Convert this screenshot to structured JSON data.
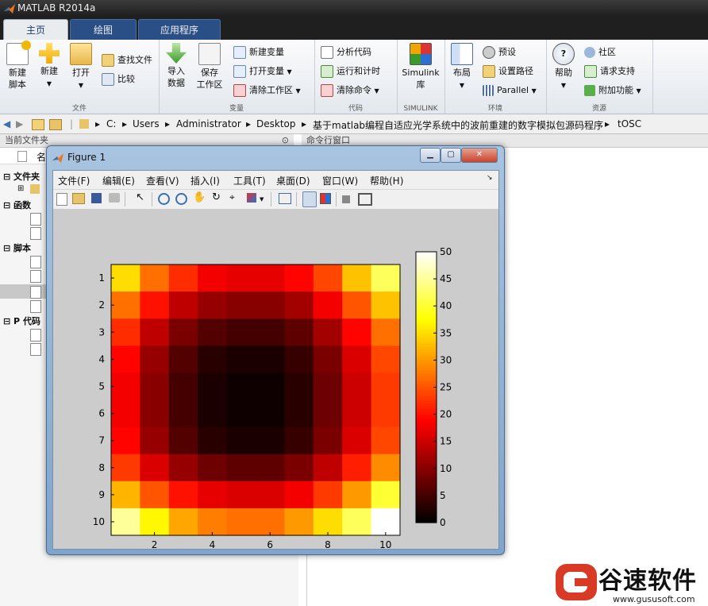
{
  "app": {
    "title": "MATLAB R2014a"
  },
  "tabs": [
    {
      "label": "主页",
      "active": true
    },
    {
      "label": "绘图"
    },
    {
      "label": "应用程序"
    }
  ],
  "ribbon": {
    "file": {
      "new_script": "新建\n脚本",
      "new": "新建",
      "open": "打开",
      "find_files": "查找文件",
      "compare": "比较",
      "title": "文件"
    },
    "variable": {
      "import": "导入\n数据",
      "save_ws": "保存\n工作区",
      "new_var": "新建变量",
      "open_var": "打开变量",
      "clear_ws": "清除工作区",
      "title": "变量"
    },
    "code": {
      "analyze": "分析代码",
      "run_time": "运行和计时",
      "clear_cmd": "清除命令",
      "title": "代码"
    },
    "simulink": {
      "lib": "Simulink\n库",
      "title": "SIMULINK"
    },
    "env": {
      "layout": "布局",
      "prefs": "预设",
      "set_path": "设置路径",
      "parallel": "Parallel",
      "title": "环境"
    },
    "res": {
      "help": "帮助",
      "community": "社区",
      "support": "请求支持",
      "addons": "附加功能",
      "title": "资源"
    }
  },
  "address": {
    "parts": [
      "C:",
      "Users",
      "Administrator",
      "Desktop",
      "基于matlab编程自适应光学系统中的波前重建的数字模拟包源码程序",
      "tOSC"
    ]
  },
  "panes": {
    "current_folder": "当前文件夹",
    "command_window": "命令行窗口"
  },
  "tree": {
    "folders": "文件夹",
    "functions": "函数",
    "scripts": "脚本",
    "pcode": "P 代码",
    "name_col": "名"
  },
  "figure": {
    "title": "Figure 1",
    "menus": [
      "文件(F)",
      "编辑(E)",
      "查看(V)",
      "插入(I)",
      "工具(T)",
      "桌面(D)",
      "窗口(W)",
      "帮助(H)"
    ]
  },
  "chart_data": {
    "type": "heatmap",
    "x": [
      1,
      2,
      3,
      4,
      5,
      6,
      7,
      8,
      9,
      10
    ],
    "y": [
      1,
      2,
      3,
      4,
      5,
      6,
      7,
      8,
      9,
      10
    ],
    "values": [
      [
        35,
        27,
        22,
        18,
        17,
        17,
        19,
        24,
        33,
        42
      ],
      [
        27,
        20,
        14,
        11,
        10,
        10,
        12,
        18,
        25,
        33
      ],
      [
        22,
        14,
        9,
        6,
        5,
        5,
        7,
        12,
        19,
        27
      ],
      [
        19,
        11,
        6,
        3,
        2,
        2,
        4,
        9,
        16,
        24
      ],
      [
        18,
        10,
        5,
        2,
        1,
        1,
        3,
        8,
        15,
        23
      ],
      [
        18,
        10,
        5,
        2,
        1,
        1,
        3,
        8,
        15,
        23
      ],
      [
        19,
        11,
        6,
        3,
        2,
        2,
        4,
        9,
        16,
        24
      ],
      [
        23,
        16,
        11,
        8,
        7,
        7,
        9,
        14,
        21,
        29
      ],
      [
        32,
        25,
        20,
        17,
        16,
        16,
        18,
        23,
        30,
        40
      ],
      [
        45,
        37,
        31,
        28,
        27,
        27,
        30,
        35,
        42,
        50
      ]
    ],
    "xticks": [
      2,
      4,
      6,
      8,
      10
    ],
    "yticks": [
      1,
      2,
      3,
      4,
      5,
      6,
      7,
      8,
      9,
      10
    ],
    "colorbar_ticks": [
      0,
      5,
      10,
      15,
      20,
      25,
      30,
      35,
      40,
      45,
      50
    ],
    "colormap": "hot",
    "clim": [
      0,
      50
    ]
  },
  "watermark": {
    "brand": "谷速软件",
    "url": "www.gususoft.com"
  }
}
